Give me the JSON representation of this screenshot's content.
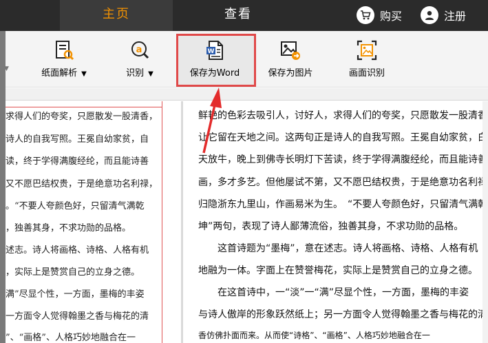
{
  "nav": {
    "tabs": [
      "主页",
      "查看"
    ],
    "buy_label": "购买",
    "register_label": "注册"
  },
  "toolbar": {
    "tools": [
      {
        "label": "纸面解析",
        "icon": "document-scan-icon",
        "has_dropdown": true
      },
      {
        "label": "识别",
        "icon": "ocr-recognize-icon",
        "has_dropdown": true
      },
      {
        "label": "保存为Word",
        "icon": "word-document-icon",
        "has_dropdown": false,
        "highlighted": true
      },
      {
        "label": "保存为图片",
        "icon": "save-image-icon",
        "has_dropdown": false
      },
      {
        "label": "画面识别",
        "icon": "screen-capture-icon",
        "has_dropdown": false
      }
    ]
  },
  "original_page": {
    "lines": [
      "求得人们的夸奖，只愿散发一股清香，",
      "诗人的自我写照。王冕自幼家贫，自",
      "读，终于学得满腹经纶，而且能诗善",
      "又不愿巴结权贵，于是绝意功名利禄，",
      "。“不要人夸颜色好，只留清气满乾",
      "，独善其身，不求功勋的品格。",
      "述志。诗人将画格、诗格、人格有机",
      "，实际上是赞赏自己的立身之德。",
      "满”尽显个性，一方面，墨梅的丰姿",
      "一方面令人觉得翰墨之香与梅花的清",
      "”、“画格”、人格巧妙地融合在一"
    ]
  },
  "recognized_page": {
    "lines": [
      "鲜艳的色彩去吸引人，讨好人，求得人们的夸奖，只愿散发一股清香，",
      "让它留在天地之间。这两句正是诗人的自我写照。王冕自幼家贫，白",
      "天放牛，晚上到佛寺长明灯下苦读，终于学得满腹经纶，而且能诗善",
      "画，多才多艺。但他屡试不第，又不愿巴结权贵，于是绝意功名利禄，",
      "归隐浙东九里山，作画易米为生。　“不要人夸颜色好，只留清气满乾",
      "坤”两句，表现了诗人鄙薄流俗，独善其身，不求功勋的品格。",
      "　　这首诗题为“墨梅”，意在述志。诗人将画格、诗格、人格有机",
      "地融为一体。字面上在赞誉梅花，实际上是赞赏自己的立身之德。",
      "　　在这首诗中，一“淡”一“满”尽显个性，一方面，墨梅的丰姿",
      "与诗人傲岸的形象跃然纸上；另一方面令人觉得翰墨之香与梅花的清",
      "香仿佛扑面而来。从而使“诗格”、“画格”、人格巧妙地融合在一"
    ]
  }
}
